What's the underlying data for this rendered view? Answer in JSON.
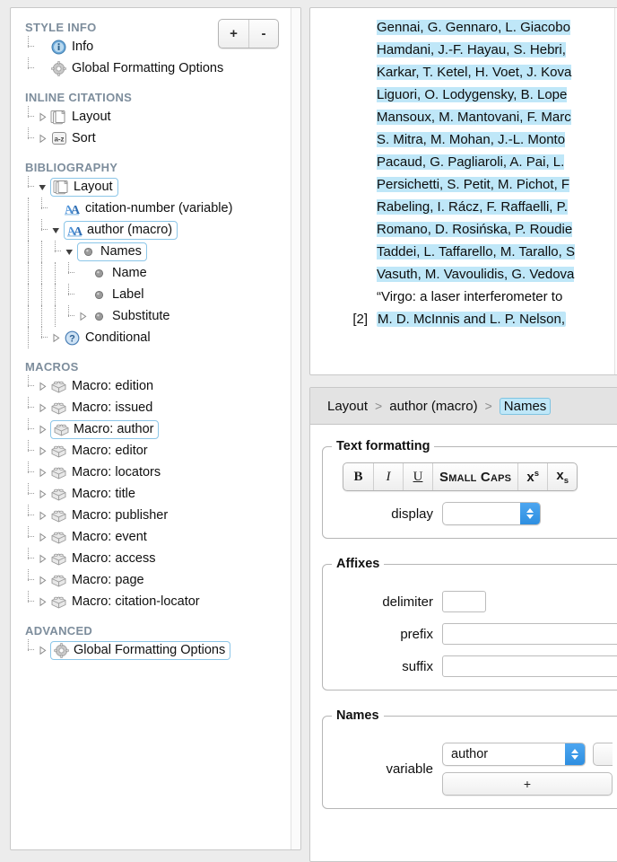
{
  "sidebar": {
    "add_label": "+",
    "remove_label": "-",
    "sections": [
      {
        "title": "STYLE INFO",
        "items": [
          {
            "label": "Info",
            "icon": "info-icon",
            "twisty": "none",
            "indent": 0,
            "selected": false
          },
          {
            "label": "Global Formatting Options",
            "icon": "gear-icon",
            "twisty": "none",
            "indent": 0,
            "selected": false
          }
        ]
      },
      {
        "title": "INLINE CITATIONS",
        "items": [
          {
            "label": "Layout",
            "icon": "layers-icon",
            "twisty": "closed",
            "indent": 0,
            "selected": false
          },
          {
            "label": "Sort",
            "icon": "sort-az-icon",
            "twisty": "closed",
            "indent": 0,
            "selected": false
          }
        ]
      },
      {
        "title": "BIBLIOGRAPHY",
        "items": [
          {
            "label": "Layout",
            "icon": "layers-icon",
            "twisty": "open",
            "indent": 0,
            "selected": true
          },
          {
            "label": "citation-number (variable)",
            "icon": "variable-aa-icon",
            "twisty": "none",
            "indent": 1,
            "selected": false
          },
          {
            "label": "author (macro)",
            "icon": "variable-aa-icon",
            "twisty": "open",
            "indent": 1,
            "selected": true
          },
          {
            "label": "Names",
            "icon": "bullet-icon",
            "twisty": "open",
            "indent": 2,
            "selected": true
          },
          {
            "label": "Name",
            "icon": "bullet-icon",
            "twisty": "none",
            "indent": 3,
            "selected": false
          },
          {
            "label": "Label",
            "icon": "bullet-icon",
            "twisty": "none",
            "indent": 3,
            "selected": false
          },
          {
            "label": "Substitute",
            "icon": "bullet-icon",
            "twisty": "closed",
            "indent": 3,
            "selected": false
          },
          {
            "label": "Conditional",
            "icon": "question-icon",
            "twisty": "closed",
            "indent": 1,
            "selected": false
          }
        ]
      },
      {
        "title": "MACROS",
        "items": [
          {
            "label": "Macro: edition",
            "icon": "macro-block-icon",
            "twisty": "closed",
            "indent": 0,
            "selected": false
          },
          {
            "label": "Macro: issued",
            "icon": "macro-block-icon",
            "twisty": "closed",
            "indent": 0,
            "selected": false
          },
          {
            "label": "Macro: author",
            "icon": "macro-block-icon",
            "twisty": "closed",
            "indent": 0,
            "selected": true
          },
          {
            "label": "Macro: editor",
            "icon": "macro-block-icon",
            "twisty": "closed",
            "indent": 0,
            "selected": false
          },
          {
            "label": "Macro: locators",
            "icon": "macro-block-icon",
            "twisty": "closed",
            "indent": 0,
            "selected": false
          },
          {
            "label": "Macro: title",
            "icon": "macro-block-icon",
            "twisty": "closed",
            "indent": 0,
            "selected": false
          },
          {
            "label": "Macro: publisher",
            "icon": "macro-block-icon",
            "twisty": "closed",
            "indent": 0,
            "selected": false
          },
          {
            "label": "Macro: event",
            "icon": "macro-block-icon",
            "twisty": "closed",
            "indent": 0,
            "selected": false
          },
          {
            "label": "Macro: access",
            "icon": "macro-block-icon",
            "twisty": "closed",
            "indent": 0,
            "selected": false
          },
          {
            "label": "Macro: page",
            "icon": "macro-block-icon",
            "twisty": "closed",
            "indent": 0,
            "selected": false
          },
          {
            "label": "Macro: citation-locator",
            "icon": "macro-block-icon",
            "twisty": "closed",
            "indent": 0,
            "selected": false
          }
        ]
      },
      {
        "title": "ADVANCED",
        "items": [
          {
            "label": "Global Formatting Options",
            "icon": "gear-icon",
            "twisty": "closed",
            "indent": 0,
            "selected": true
          }
        ]
      }
    ]
  },
  "preview": {
    "entry1": {
      "number": "",
      "lines": [
        {
          "text": "Gennai, G. Gennaro, L. Giacobo",
          "highlight": true
        },
        {
          "text": "Hamdani, J.-F. Hayau, S. Hebri,",
          "highlight": true
        },
        {
          "text": "Karkar, T. Ketel, H. Voet, J. Kova",
          "highlight": true
        },
        {
          "text": "Liguori, O. Lodygensky, B. Lope",
          "highlight": true
        },
        {
          "text": "Mansoux, M. Mantovani, F. Marc",
          "highlight": true
        },
        {
          "text": "S. Mitra, M. Mohan, J.-L. Monto",
          "highlight": true
        },
        {
          "text": "Pacaud, G. Pagliaroli, A. Pai, L. ",
          "highlight": true
        },
        {
          "text": "Persichetti, S. Petit, M. Pichot, F",
          "highlight": true
        },
        {
          "text": "Rabeling, I. Rácz, F. Raffaelli, P. ",
          "highlight": true
        },
        {
          "text": "Romano, D. Rosińska, P. Roudie",
          "highlight": true
        },
        {
          "text": "Taddei, L. Taffarello, M. Tarallo, S",
          "highlight": true
        },
        {
          "text": "Vasuth, M. Vavoulidis, G. Vedova",
          "highlight": true
        },
        {
          "text": "“Virgo: a laser interferometer to ",
          "highlight": false
        }
      ]
    },
    "entry2": {
      "number": "[2]",
      "lines": [
        {
          "text": "M. D. McInnis and L. P. Nelson, ",
          "highlight": true
        }
      ]
    }
  },
  "inspector": {
    "breadcrumb": [
      {
        "label": "Layout",
        "active": false
      },
      {
        "label": "author (macro)",
        "active": false
      },
      {
        "label": "Names",
        "active": true
      }
    ],
    "breadcrumb_separator": ">",
    "text_formatting": {
      "legend": "Text formatting",
      "buttons": [
        {
          "name": "bold-button",
          "label": "B"
        },
        {
          "name": "italic-button",
          "label": "I"
        },
        {
          "name": "underline-button",
          "label": "U"
        },
        {
          "name": "small-caps-button",
          "label": "Small Caps"
        },
        {
          "name": "superscript-button",
          "label": "x"
        },
        {
          "name": "subscript-button",
          "label": "x"
        }
      ],
      "superscript_affix": "s",
      "subscript_affix": "s",
      "display_label": "display",
      "display_value": ""
    },
    "affixes": {
      "legend": "Affixes",
      "delimiter_label": "delimiter",
      "delimiter_value": "",
      "prefix_label": "prefix",
      "prefix_value": "",
      "suffix_label": "suffix",
      "suffix_value": ""
    },
    "names": {
      "legend": "Names",
      "variable_label": "variable",
      "variable_value": "author",
      "add_label": "+"
    }
  },
  "colors": {
    "selection_highlight": "#bfe7f8",
    "section_header": "#7d8d9c",
    "selected_outline": "#8cc6e8",
    "stepper_blue": "#3d9bea",
    "panel_bg": "#ffffff",
    "window_bg": "#ececec"
  }
}
